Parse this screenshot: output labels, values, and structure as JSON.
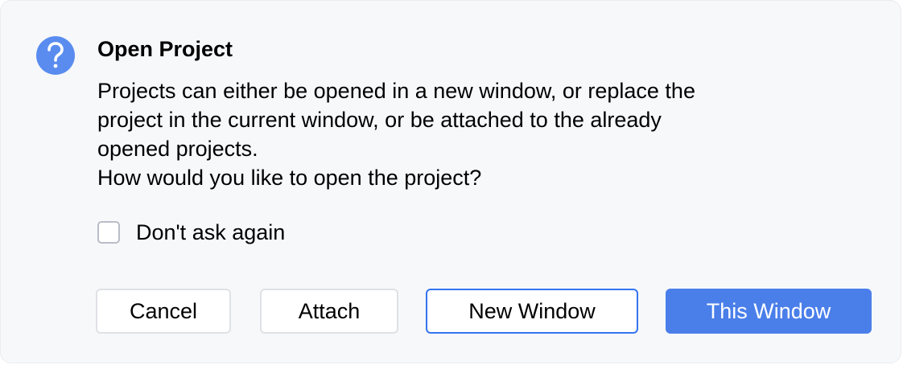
{
  "dialog": {
    "icon": "question-icon",
    "accent_color": "#3574f0",
    "title": "Open Project",
    "message_lines": [
      "Projects can either be opened in a new window, or replace the",
      "project in the current window, or be attached to the already",
      "opened projects.",
      "How would you like to open the project?"
    ],
    "dont_ask_again": {
      "label": "Don't ask again",
      "checked": false
    },
    "buttons": {
      "cancel": "Cancel",
      "attach": "Attach",
      "new_window": "New Window",
      "this_window": "This Window"
    }
  }
}
